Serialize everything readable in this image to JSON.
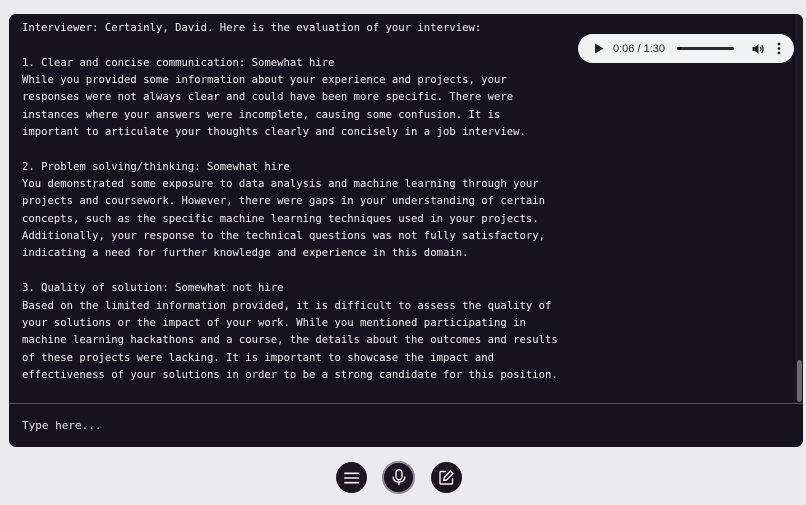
{
  "transcript": {
    "lines": [
      "Interviewer: Certainly, David. Here is the evaluation of your interview:",
      "",
      "1. Clear and concise communication: Somewhat hire",
      "While you provided some information about your experience and projects, your",
      "responses were not always clear and could have been more specific. There were",
      "instances where your answers were incomplete, causing some confusion. It is",
      "important to articulate your thoughts clearly and concisely in a job interview.",
      "",
      "2. Problem solving/thinking: Somewhat hire",
      "You demonstrated some exposure to data analysis and machine learning through your",
      "projects and coursework. However, there were gaps in your understanding of certain",
      "concepts, such as the specific machine learning techniques used in your projects.",
      "Additionally, your response to the technical questions was not fully satisfactory,",
      "indicating a need for further knowledge and experience in this domain.",
      "",
      "3. Quality of solution: Somewhat not hire",
      "Based on the limited information provided, it is difficult to assess the quality of",
      "your solutions or the impact of your work. While you mentioned participating in",
      "machine learning hackathons and a course, the details about the outcomes and results",
      "of these projects were lacking. It is important to showcase the impact and",
      "effectiveness of your solutions in order to be a strong candidate for this position."
    ]
  },
  "audio_player": {
    "time_display": "0:06 / 1:30",
    "progress_fraction": 0.0667
  },
  "input": {
    "placeholder": "Type here...",
    "value": ""
  },
  "toolbar": {
    "menu_icon": "menu-icon",
    "mic_icon": "microphone-icon",
    "edit_icon": "edit-icon"
  },
  "colors": {
    "page_background": "#ebebed",
    "panel_background": "#17121f",
    "text": "#f2f2f2",
    "button_background": "#1b1622"
  }
}
